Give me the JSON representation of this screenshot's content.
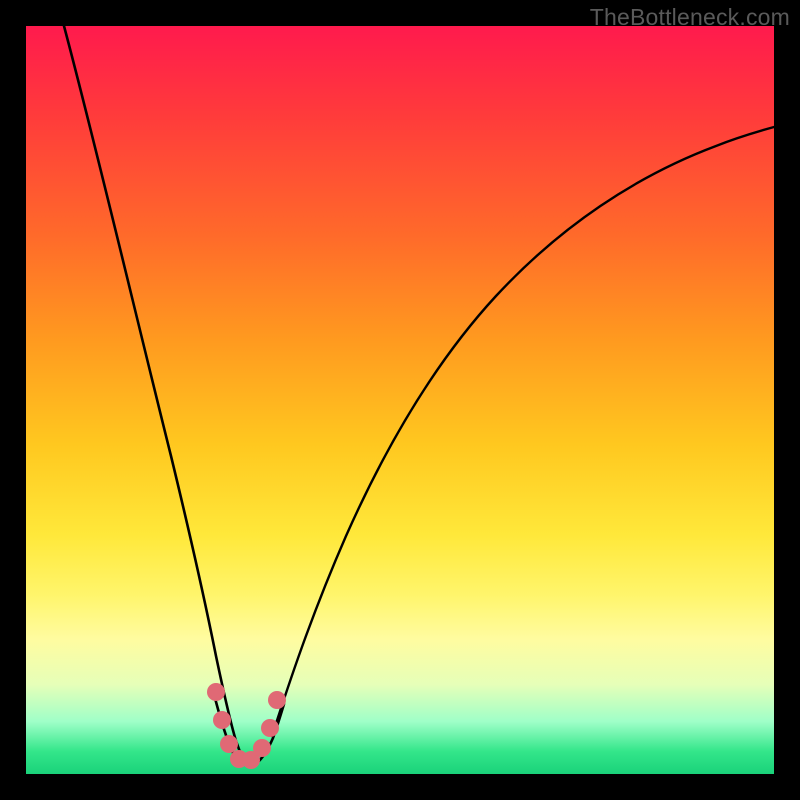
{
  "watermark": "TheBottleneck.com",
  "chart_data": {
    "type": "line",
    "title": "",
    "xlabel": "",
    "ylabel": "",
    "xlim": [
      0,
      100
    ],
    "ylim": [
      0,
      100
    ],
    "series": [
      {
        "name": "bottleneck-curve",
        "x": [
          0,
          4,
          8,
          12,
          15,
          18,
          20,
          22,
          24,
          25,
          26,
          27,
          28,
          29,
          30,
          32,
          35,
          38,
          42,
          46,
          50,
          55,
          60,
          65,
          70,
          75,
          80,
          85,
          90,
          95,
          100
        ],
        "values": [
          100,
          88,
          76,
          63,
          53,
          42,
          34,
          25,
          15,
          9,
          4,
          1,
          0,
          0,
          1,
          5,
          13,
          22,
          32,
          41,
          48,
          55,
          61,
          66,
          70,
          74,
          77,
          79,
          81,
          83,
          85
        ]
      }
    ],
    "markers": {
      "name": "highlight-dots",
      "color": "#e06975",
      "points": [
        {
          "x": 24.0,
          "y": 12
        },
        {
          "x": 24.8,
          "y": 7
        },
        {
          "x": 25.7,
          "y": 3
        },
        {
          "x": 27.0,
          "y": 1
        },
        {
          "x": 28.5,
          "y": 1
        },
        {
          "x": 29.5,
          "y": 3
        },
        {
          "x": 30.3,
          "y": 6
        },
        {
          "x": 31.2,
          "y": 11
        }
      ]
    },
    "gradient_stops": [
      {
        "pos": 0,
        "color": "#ff1a4d"
      },
      {
        "pos": 50,
        "color": "#ffc81f"
      },
      {
        "pos": 80,
        "color": "#fff56b"
      },
      {
        "pos": 100,
        "color": "#1ad27a"
      }
    ]
  }
}
